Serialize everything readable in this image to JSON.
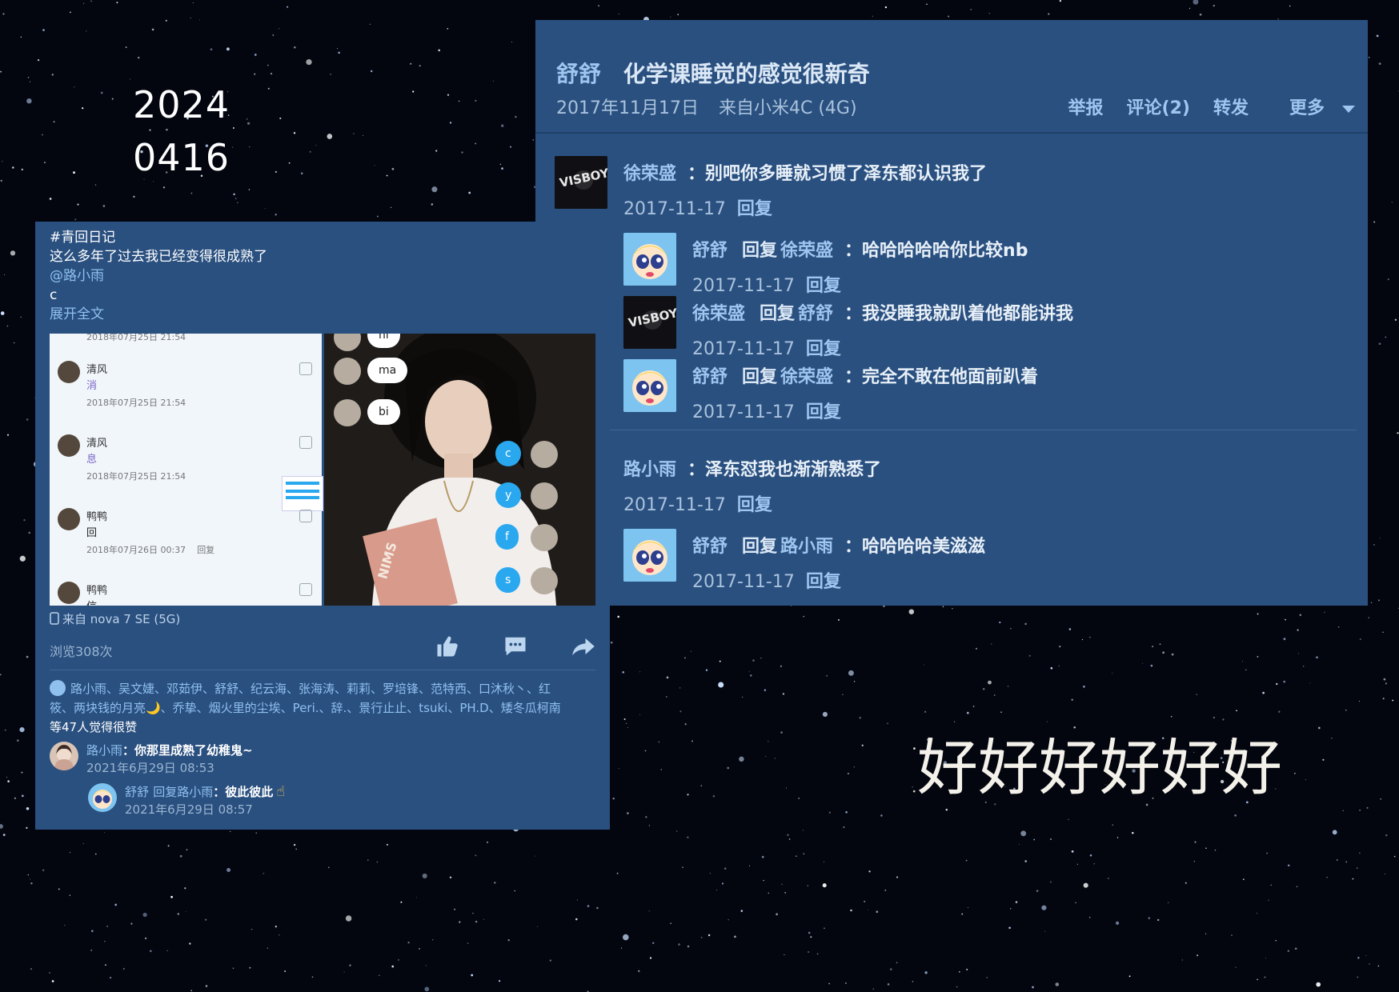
{
  "overlay": {
    "date_line1": "2024",
    "date_line2": "0416",
    "big_text": "好好好好好好"
  },
  "post_a": {
    "author": "舒舒",
    "title": "化学课睡觉的感觉很新奇",
    "date": "2017年11月17日",
    "source": "来自小米4C (4G)",
    "actions": {
      "report": "举报",
      "comments": "评论(2)",
      "repost": "转发",
      "more": "更多"
    },
    "comments": [
      {
        "user": "徐荣盛",
        "text": "：别吧你多睡就习惯了泽东都认识我了",
        "time": "2017-11-17",
        "reply": "回复",
        "avatar": "dark"
      },
      {
        "user": "舒舒",
        "reply_word": "回复",
        "target": "徐荣盛",
        "text": "：哈哈哈哈哈你比较nb",
        "time": "2017-11-17",
        "reply": "回复",
        "avatar": "pp"
      },
      {
        "user": "徐荣盛",
        "reply_word": "回复",
        "target": "舒舒",
        "text": "：我没睡我就趴着他都能讲我",
        "time": "2017-11-17",
        "reply": "回复",
        "avatar": "dark"
      },
      {
        "user": "舒舒",
        "reply_word": "回复",
        "target": "徐荣盛",
        "text": "：完全不敢在他面前趴着",
        "time": "2017-11-17",
        "reply": "回复",
        "avatar": "pp"
      },
      {
        "user": "路小雨",
        "text": "：泽东怼我也渐渐熟悉了",
        "time": "2017-11-17",
        "reply": "回复"
      },
      {
        "user": "舒舒",
        "reply_word": "回复",
        "target": "路小雨",
        "text": "：哈哈哈哈美滋滋",
        "time": "2017-11-17",
        "reply": "回复",
        "avatar": "pp"
      }
    ]
  },
  "post_b": {
    "tag": "#青回日记",
    "line1": "这么多年了过去我已经变得很成熟了",
    "mention": "@路小雨",
    "line3": "c",
    "expand": "展开全文",
    "from": "来自 nova 7 SE (5G)",
    "views": "浏览308次",
    "likes_names": "路小雨、吴文婕、邓茹伊、舒舒、纪云海、张海涛、莉莉、罗培锋、范特西、口沐秋丶、红筱、两块钱的月亮🌙、乔挚、烟火里的尘埃、Peri.、辞.、景行止止、tsuki、PH.D、矮冬瓜柯南",
    "likes_rest": "等47人觉得很赞",
    "comment": {
      "user": "路小雨",
      "text": "：你那里成熟了幼稚鬼~",
      "time": "2021年6月29日 08:53"
    },
    "reply": {
      "user": "舒舒",
      "reply_word": "回复",
      "target": "路小雨",
      "text": "：彼此彼此",
      "emoji": "☝",
      "time": "2021年6月29日 08:57"
    },
    "screenshot": {
      "left": {
        "top_time": "2018年07月25日 21:54",
        "items": [
          {
            "name": "清风",
            "msg": "消",
            "time": "2018年07月25日 21:54"
          },
          {
            "name": "清风",
            "msg": "息",
            "time": "2018年07月25日 21:54"
          },
          {
            "name": "鸭鸭",
            "msg": "回",
            "time": "2018年07月26日 00:37",
            "reply": "回复"
          },
          {
            "name": "鸭鸭",
            "msg": "信"
          }
        ]
      },
      "right": {
        "left_bubbles": [
          "ni",
          "ma",
          "bi"
        ],
        "right_bubbles": [
          "c",
          "y",
          "f",
          "s"
        ],
        "book_text": "NIMS"
      }
    }
  },
  "colors": {
    "panel_bg": "#2a5080",
    "link": "#9ec6ef",
    "sky": "#03060f"
  }
}
